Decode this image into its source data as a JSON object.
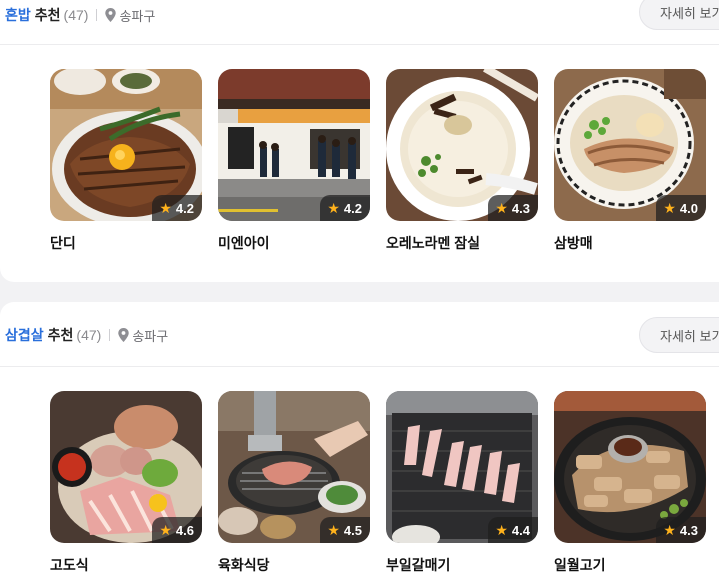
{
  "sections": [
    {
      "keyword": "혼밥",
      "suffix": "추천",
      "count": "(47)",
      "location": "송파구",
      "more_label": "자세히 보기",
      "cards": [
        {
          "name": "단디",
          "rating": "4.2",
          "image": "steak-rice-bowl-photo"
        },
        {
          "name": "미엔아이",
          "rating": "4.2",
          "image": "restaurant-storefront-photo"
        },
        {
          "name": "오레노라멘 잠실",
          "rating": "4.3",
          "image": "white-broth-ramen-photo"
        },
        {
          "name": "삼방매",
          "rating": "4.0",
          "image": "pork-ramen-bowl-photo"
        }
      ]
    },
    {
      "keyword": "삼겹살",
      "suffix": "추천",
      "count": "(47)",
      "location": "송파구",
      "more_label": "자세히 보기",
      "cards": [
        {
          "name": "고도식",
          "rating": "4.6",
          "image": "pork-platter-photo"
        },
        {
          "name": "육화식당",
          "rating": "4.5",
          "image": "grill-table-photo"
        },
        {
          "name": "부일갈매기",
          "rating": "4.4",
          "image": "grill-plate-photo"
        },
        {
          "name": "일월고기",
          "rating": "4.3",
          "image": "pork-belly-grill-photo"
        }
      ]
    }
  ],
  "colors": {
    "keyword": "#2a6fdb",
    "star": "#ffb21c"
  }
}
